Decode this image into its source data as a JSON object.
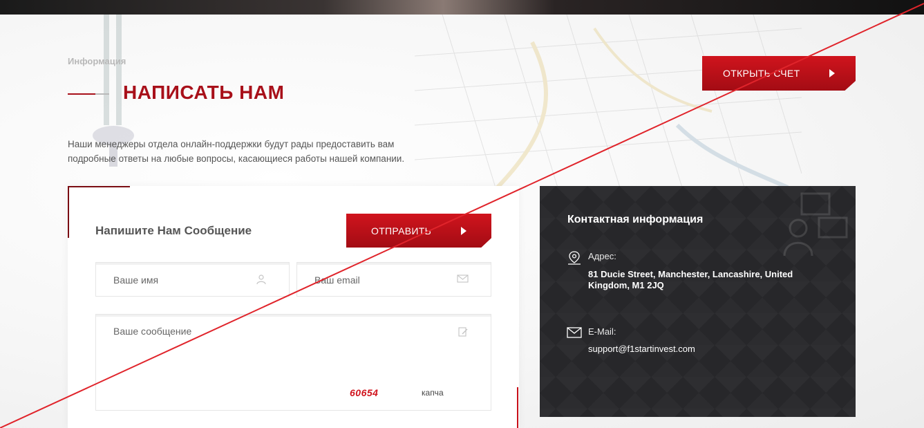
{
  "header": {
    "breadcrumb": "Информация",
    "title": "НАПИСАТЬ НАМ",
    "open_account_label": "ОТКРЫТЬ СЧЕТ"
  },
  "intro": {
    "line1": "Наши менеджеры отдела онлайн-поддержки будут рады предоставить вам",
    "line2": "подробные ответы на любые вопросы, касающиеся работы нашей компании."
  },
  "form": {
    "title": "Напишите Нам Сообщение",
    "send_label": "ОТПРАВИТЬ",
    "name_placeholder": "Ваше имя",
    "email_placeholder": "Ваш email",
    "message_placeholder": "Ваше сообщение",
    "captcha_code": "60654",
    "captcha_label": "капча"
  },
  "contact": {
    "title": "Контактная информация",
    "address_label": "Адрес:",
    "address_value": "81 Ducie Street, Manchester, Lancashire, United Kingdom, M1 2JQ",
    "email_label": "E-Mail:",
    "email_value": "support@f1startinvest.com"
  },
  "colors": {
    "accent": "#c8101a",
    "title_red": "#a8101a",
    "panel_dark": "#27272a",
    "overlay_line": "#e0242b"
  },
  "icons": [
    "user-icon",
    "envelope-icon",
    "edit-icon",
    "location-pin-icon",
    "mail-icon",
    "play-arrow-icon"
  ]
}
